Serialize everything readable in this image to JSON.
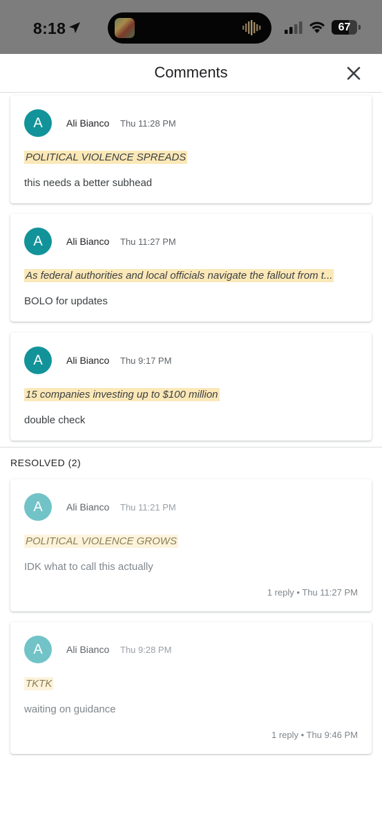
{
  "status_bar": {
    "time": "8:18",
    "battery": "67",
    "battery_level": 0.67
  },
  "header": {
    "title": "Comments"
  },
  "open_comments": [
    {
      "avatar": "A",
      "author": "Ali Bianco",
      "time": "Thu 11:28 PM",
      "quote": "POLITICAL VIOLENCE SPREADS",
      "text": "this needs a better subhead"
    },
    {
      "avatar": "A",
      "author": "Ali Bianco",
      "time": "Thu 11:27 PM",
      "quote": "As federal authorities and local officials navigate the fallout from t...",
      "text": "BOLO for updates"
    },
    {
      "avatar": "A",
      "author": "Ali Bianco",
      "time": "Thu 9:17 PM",
      "quote": "15 companies investing up to $100 million",
      "text": "double check"
    }
  ],
  "resolved": {
    "label": "RESOLVED (2)",
    "items": [
      {
        "avatar": "A",
        "author": "Ali Bianco",
        "time": "Thu 11:21 PM",
        "quote": "POLITICAL VIOLENCE GROWS",
        "text": "IDK what to call this actually",
        "meta": "1 reply • Thu 11:27 PM"
      },
      {
        "avatar": "A",
        "author": "Ali Bianco",
        "time": "Thu 9:28 PM",
        "quote": "TKTK",
        "text": "waiting on guidance",
        "meta": "1 reply • Thu 9:46 PM"
      }
    ]
  },
  "colors": {
    "avatar_active": "#12939a",
    "avatar_resolved": "#71c3c8",
    "quote_highlight": "#fbe8b7"
  },
  "icons": {
    "close": "close-icon",
    "location": "location-arrow-icon",
    "signal": "cellular-signal-icon",
    "wifi": "wifi-icon",
    "battery": "battery-icon"
  }
}
